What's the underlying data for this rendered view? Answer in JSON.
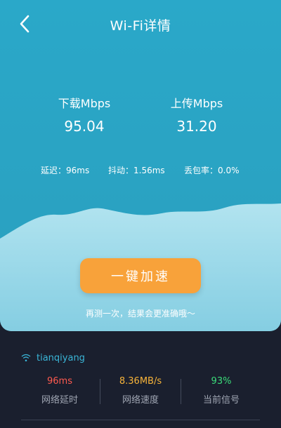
{
  "header": {
    "title": "Wi-Fi详情",
    "back_icon": "chevron-left-icon"
  },
  "speed": {
    "download_label": "下载Mbps",
    "download_value": "95.04",
    "upload_label": "上传Mbps",
    "upload_value": "31.20"
  },
  "stats": {
    "latency": "延迟：96ms",
    "jitter": "抖动：1.56ms",
    "packet_loss": "丢包率：0.0%"
  },
  "cta": {
    "label": "一键加速",
    "color": "#f8a23a"
  },
  "hint": "再测一次，结果会更准确哦～",
  "network": {
    "wifi_icon": "wifi-icon",
    "ssid": "tianqiyang",
    "metrics": [
      {
        "value": "96ms",
        "label": "网络延时",
        "color": "#ff5a4f"
      },
      {
        "value": "8.36MB/s",
        "label": "网络速度",
        "color": "#f8b43a"
      },
      {
        "value": "93%",
        "label": "当前信号",
        "color": "#3bdc7a"
      }
    ]
  },
  "colors": {
    "header_bg": "#2aa8c9",
    "panel_bg": "#1a1f2e",
    "ssid": "#3ab6d8"
  }
}
